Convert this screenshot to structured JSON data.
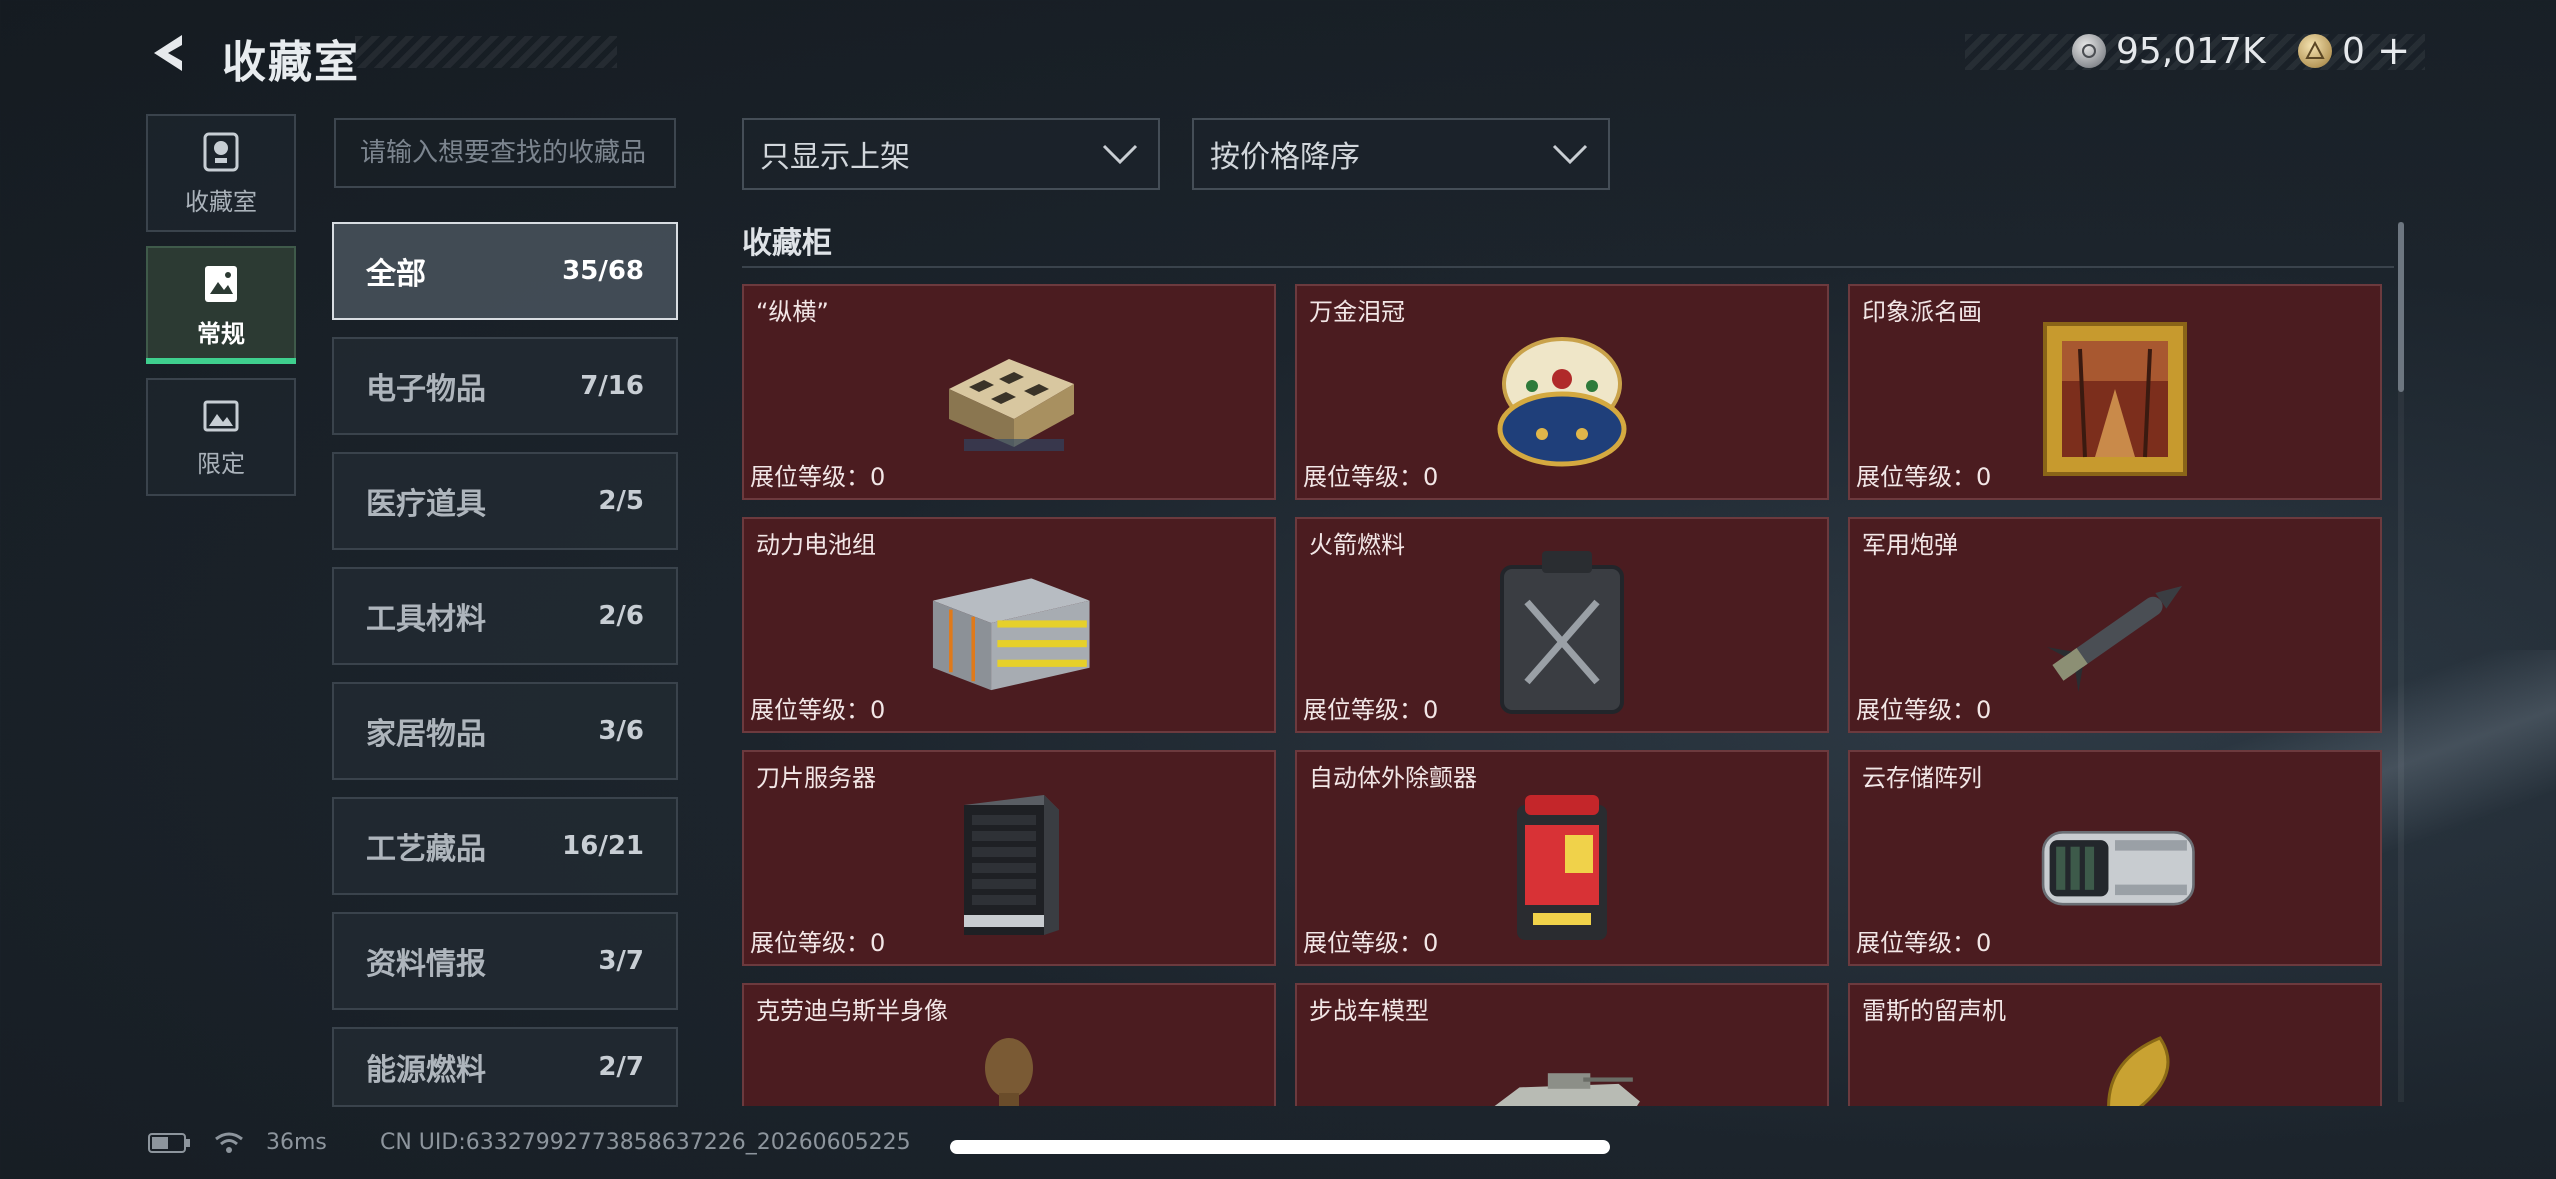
{
  "header": {
    "title": "收藏室",
    "currency_silver": "95,017K",
    "currency_gold": "0"
  },
  "side_tabs": [
    {
      "label": "收藏室",
      "icon": "trophy-icon"
    },
    {
      "label": "常规",
      "icon": "image-book-icon"
    },
    {
      "label": "限定",
      "icon": "picture-icon"
    }
  ],
  "search": {
    "placeholder": "请输入想要查找的收藏品"
  },
  "categories": [
    {
      "name": "全部",
      "count": "35/68"
    },
    {
      "name": "电子物品",
      "count": "7/16"
    },
    {
      "name": "医疗道具",
      "count": "2/5"
    },
    {
      "name": "工具材料",
      "count": "2/6"
    },
    {
      "name": "家居物品",
      "count": "3/6"
    },
    {
      "name": "工艺藏品",
      "count": "16/21"
    },
    {
      "name": "资料情报",
      "count": "3/7"
    },
    {
      "name": "能源燃料",
      "count": "2/7"
    }
  ],
  "filters": {
    "listing": "只显示上架",
    "sort": "按价格降序"
  },
  "section_title": "收藏柜",
  "items": [
    {
      "name": "“纵横”",
      "level": "展位等级：0",
      "icon": "chess-box-icon"
    },
    {
      "name": "万金泪冠",
      "level": "展位等级：0",
      "icon": "jeweled-egg-icon"
    },
    {
      "name": "印象派名画",
      "level": "展位等级：0",
      "icon": "framed-painting-icon"
    },
    {
      "name": "动力电池组",
      "level": "展位等级：0",
      "icon": "battery-pack-icon"
    },
    {
      "name": "火箭燃料",
      "level": "展位等级：0",
      "icon": "jerrycan-icon"
    },
    {
      "name": "军用炮弹",
      "level": "展位等级：0",
      "icon": "missile-icon"
    },
    {
      "name": "刀片服务器",
      "level": "展位等级：0",
      "icon": "blade-server-icon"
    },
    {
      "name": "自动体外除颤器",
      "level": "展位等级：0",
      "icon": "defibrillator-icon"
    },
    {
      "name": "云存储阵列",
      "level": "展位等级：0",
      "icon": "storage-array-icon"
    },
    {
      "name": "克劳迪乌斯半身像",
      "level": "",
      "icon": "bust-statue-icon"
    },
    {
      "name": "步战车模型",
      "level": "",
      "icon": "armored-vehicle-icon"
    },
    {
      "name": "雷斯的留声机",
      "level": "",
      "icon": "gramophone-icon"
    }
  ],
  "status": {
    "ping": "36ms",
    "uid": "CN UID:6332799277385863722​6_20260605225"
  }
}
